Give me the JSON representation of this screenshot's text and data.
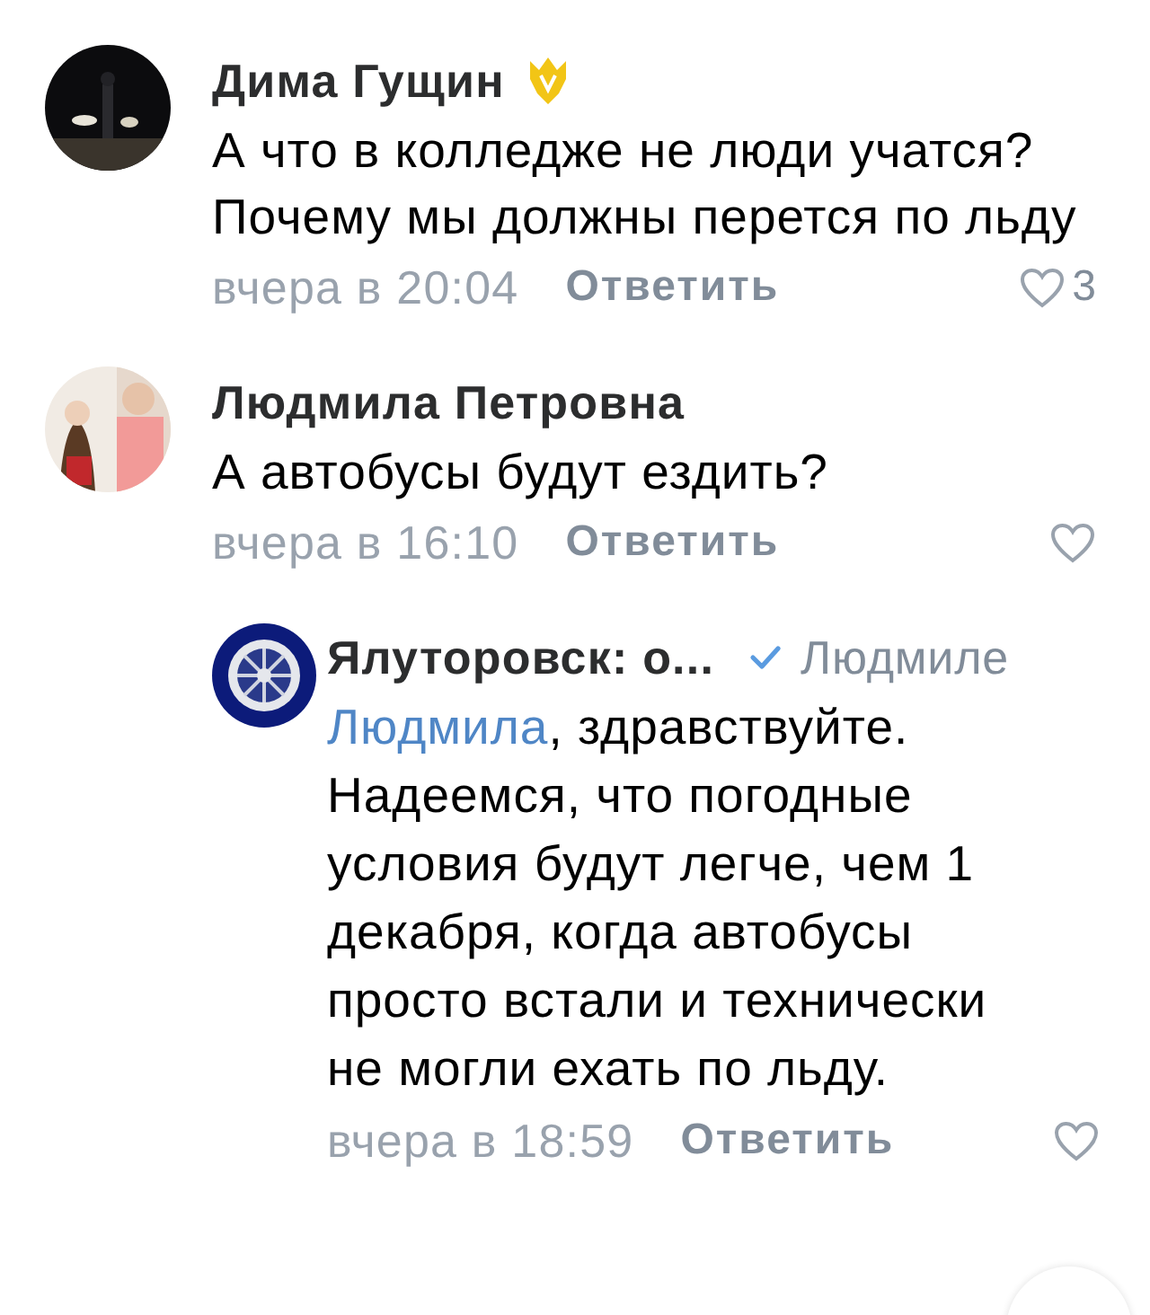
{
  "comments": [
    {
      "kind": "comment",
      "avatar": {
        "kind": "night_photo"
      },
      "author": "Дима Гущин",
      "badge": true,
      "text": "А что в колледже не люди учатся? Почему мы должны перется по льду",
      "time": "вчера в 20:04",
      "reply": "Ответить",
      "liked": false,
      "likes": "3"
    },
    {
      "kind": "comment",
      "avatar": {
        "kind": "people_photo"
      },
      "author": "Людмила Петровна",
      "text": "А автобусы будут ездить?",
      "time": "вчера в 16:10",
      "reply": "Ответить",
      "liked": false
    },
    {
      "kind": "reply",
      "avatar": {
        "kind": "wheel_logo"
      },
      "author": "Ялуторовск: о...",
      "verified": true,
      "reply_to": "Людмиле",
      "mention": "Людмила",
      "text": ", здравствуйте. Надеемся, что погодные условия будут легче, чем 1 декабря, когда автобусы просто встали и технически не могли ехать по льду.",
      "time": "вчера в 18:59",
      "reply": "Ответить",
      "liked": false
    }
  ]
}
